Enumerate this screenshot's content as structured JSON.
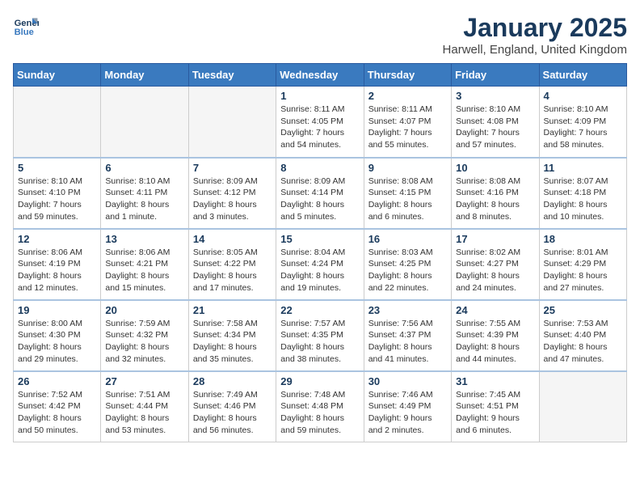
{
  "header": {
    "logo_line1": "General",
    "logo_line2": "Blue",
    "month_title": "January 2025",
    "location": "Harwell, England, United Kingdom"
  },
  "weekdays": [
    "Sunday",
    "Monday",
    "Tuesday",
    "Wednesday",
    "Thursday",
    "Friday",
    "Saturday"
  ],
  "weeks": [
    [
      {
        "day": "",
        "info": ""
      },
      {
        "day": "",
        "info": ""
      },
      {
        "day": "",
        "info": ""
      },
      {
        "day": "1",
        "info": "Sunrise: 8:11 AM\nSunset: 4:05 PM\nDaylight: 7 hours\nand 54 minutes."
      },
      {
        "day": "2",
        "info": "Sunrise: 8:11 AM\nSunset: 4:07 PM\nDaylight: 7 hours\nand 55 minutes."
      },
      {
        "day": "3",
        "info": "Sunrise: 8:10 AM\nSunset: 4:08 PM\nDaylight: 7 hours\nand 57 minutes."
      },
      {
        "day": "4",
        "info": "Sunrise: 8:10 AM\nSunset: 4:09 PM\nDaylight: 7 hours\nand 58 minutes."
      }
    ],
    [
      {
        "day": "5",
        "info": "Sunrise: 8:10 AM\nSunset: 4:10 PM\nDaylight: 7 hours\nand 59 minutes."
      },
      {
        "day": "6",
        "info": "Sunrise: 8:10 AM\nSunset: 4:11 PM\nDaylight: 8 hours\nand 1 minute."
      },
      {
        "day": "7",
        "info": "Sunrise: 8:09 AM\nSunset: 4:12 PM\nDaylight: 8 hours\nand 3 minutes."
      },
      {
        "day": "8",
        "info": "Sunrise: 8:09 AM\nSunset: 4:14 PM\nDaylight: 8 hours\nand 5 minutes."
      },
      {
        "day": "9",
        "info": "Sunrise: 8:08 AM\nSunset: 4:15 PM\nDaylight: 8 hours\nand 6 minutes."
      },
      {
        "day": "10",
        "info": "Sunrise: 8:08 AM\nSunset: 4:16 PM\nDaylight: 8 hours\nand 8 minutes."
      },
      {
        "day": "11",
        "info": "Sunrise: 8:07 AM\nSunset: 4:18 PM\nDaylight: 8 hours\nand 10 minutes."
      }
    ],
    [
      {
        "day": "12",
        "info": "Sunrise: 8:06 AM\nSunset: 4:19 PM\nDaylight: 8 hours\nand 12 minutes."
      },
      {
        "day": "13",
        "info": "Sunrise: 8:06 AM\nSunset: 4:21 PM\nDaylight: 8 hours\nand 15 minutes."
      },
      {
        "day": "14",
        "info": "Sunrise: 8:05 AM\nSunset: 4:22 PM\nDaylight: 8 hours\nand 17 minutes."
      },
      {
        "day": "15",
        "info": "Sunrise: 8:04 AM\nSunset: 4:24 PM\nDaylight: 8 hours\nand 19 minutes."
      },
      {
        "day": "16",
        "info": "Sunrise: 8:03 AM\nSunset: 4:25 PM\nDaylight: 8 hours\nand 22 minutes."
      },
      {
        "day": "17",
        "info": "Sunrise: 8:02 AM\nSunset: 4:27 PM\nDaylight: 8 hours\nand 24 minutes."
      },
      {
        "day": "18",
        "info": "Sunrise: 8:01 AM\nSunset: 4:29 PM\nDaylight: 8 hours\nand 27 minutes."
      }
    ],
    [
      {
        "day": "19",
        "info": "Sunrise: 8:00 AM\nSunset: 4:30 PM\nDaylight: 8 hours\nand 29 minutes."
      },
      {
        "day": "20",
        "info": "Sunrise: 7:59 AM\nSunset: 4:32 PM\nDaylight: 8 hours\nand 32 minutes."
      },
      {
        "day": "21",
        "info": "Sunrise: 7:58 AM\nSunset: 4:34 PM\nDaylight: 8 hours\nand 35 minutes."
      },
      {
        "day": "22",
        "info": "Sunrise: 7:57 AM\nSunset: 4:35 PM\nDaylight: 8 hours\nand 38 minutes."
      },
      {
        "day": "23",
        "info": "Sunrise: 7:56 AM\nSunset: 4:37 PM\nDaylight: 8 hours\nand 41 minutes."
      },
      {
        "day": "24",
        "info": "Sunrise: 7:55 AM\nSunset: 4:39 PM\nDaylight: 8 hours\nand 44 minutes."
      },
      {
        "day": "25",
        "info": "Sunrise: 7:53 AM\nSunset: 4:40 PM\nDaylight: 8 hours\nand 47 minutes."
      }
    ],
    [
      {
        "day": "26",
        "info": "Sunrise: 7:52 AM\nSunset: 4:42 PM\nDaylight: 8 hours\nand 50 minutes."
      },
      {
        "day": "27",
        "info": "Sunrise: 7:51 AM\nSunset: 4:44 PM\nDaylight: 8 hours\nand 53 minutes."
      },
      {
        "day": "28",
        "info": "Sunrise: 7:49 AM\nSunset: 4:46 PM\nDaylight: 8 hours\nand 56 minutes."
      },
      {
        "day": "29",
        "info": "Sunrise: 7:48 AM\nSunset: 4:48 PM\nDaylight: 8 hours\nand 59 minutes."
      },
      {
        "day": "30",
        "info": "Sunrise: 7:46 AM\nSunset: 4:49 PM\nDaylight: 9 hours\nand 2 minutes."
      },
      {
        "day": "31",
        "info": "Sunrise: 7:45 AM\nSunset: 4:51 PM\nDaylight: 9 hours\nand 6 minutes."
      },
      {
        "day": "",
        "info": ""
      }
    ]
  ]
}
